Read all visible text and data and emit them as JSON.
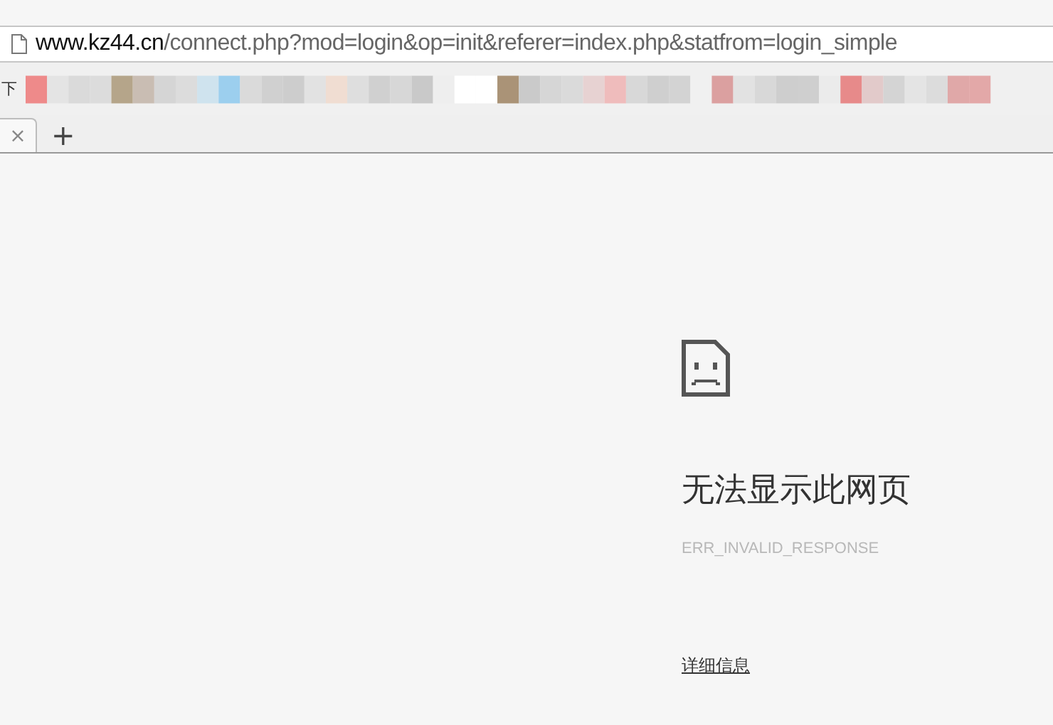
{
  "address_bar": {
    "host": "www.kz44.cn",
    "path": "/connect.php?mod=login&op=init&referer=index.php&statfrom=login_simple"
  },
  "bookmarks_bar": {
    "label": "下"
  },
  "tabs": [
    {
      "close": "×",
      "selected": true
    }
  ],
  "new_tab": "+",
  "error_page": {
    "title": "无法显示此网页",
    "code": "ERR_INVALID_RESPONSE",
    "link": "详细信息"
  }
}
